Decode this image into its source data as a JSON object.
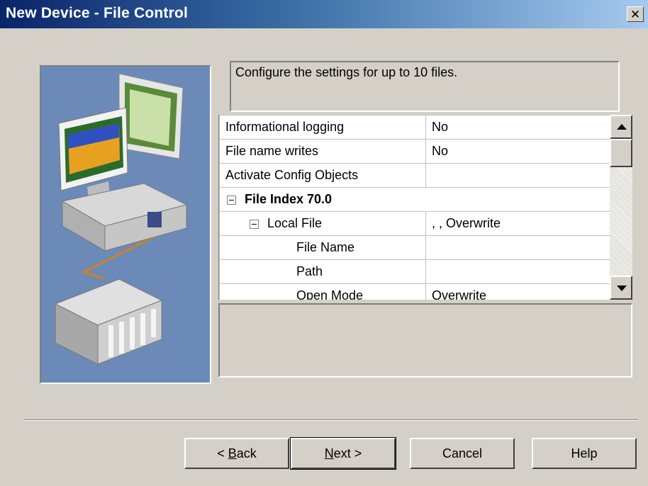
{
  "window": {
    "title": "New Device - File Control",
    "close_glyph": "✕"
  },
  "description": "Configure the settings for up to 10 files.",
  "properties": [
    {
      "name": "Informational logging",
      "value": "No",
      "type": "plain"
    },
    {
      "name": "File name writes",
      "value": "No",
      "type": "plain"
    },
    {
      "name": "Activate Config Objects",
      "value": "",
      "type": "plain"
    },
    {
      "name": "File Index 70.0",
      "value": "",
      "type": "group"
    },
    {
      "name": "Local File",
      "value": ", , Overwrite",
      "type": "subgroup"
    },
    {
      "name": "File Name",
      "value": "",
      "type": "child"
    },
    {
      "name": "Path",
      "value": "",
      "type": "child"
    },
    {
      "name": "Open Mode",
      "value": "Overwrite",
      "type": "child"
    }
  ],
  "buttons": {
    "back": {
      "prefix": "< ",
      "accel": "B",
      "rest": "ack"
    },
    "next": {
      "accel": "N",
      "rest": "ext >"
    },
    "cancel": "Cancel",
    "help": "Help"
  },
  "icons": {
    "illustration": "computer-network-plc-illustration",
    "close": "close-icon",
    "expand": "minus-box-icon"
  },
  "colors": {
    "title_gradient_start": "#0a246a",
    "title_gradient_end": "#a6caf0",
    "dialog_bg": "#d4d0c8",
    "illustration_bg": "#6b8ab8"
  }
}
